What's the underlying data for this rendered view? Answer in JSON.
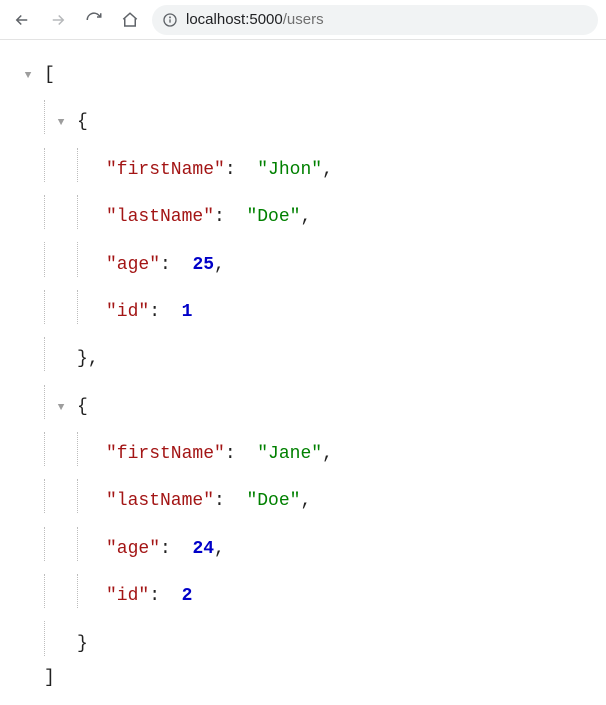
{
  "toolbar": {
    "url_host": "localhost:5000",
    "url_path": "/users"
  },
  "json": {
    "open_bracket": "[",
    "close_bracket": "]",
    "open_brace": "{",
    "close_brace": "}",
    "comma": ",",
    "colon": ":",
    "quote": "\"",
    "users": [
      {
        "props": [
          {
            "key": "firstName",
            "type": "string",
            "value": "Jhon"
          },
          {
            "key": "lastName",
            "type": "string",
            "value": "Doe"
          },
          {
            "key": "age",
            "type": "number",
            "value": "25"
          },
          {
            "key": "id",
            "type": "number",
            "value": "1"
          }
        ]
      },
      {
        "props": [
          {
            "key": "firstName",
            "type": "string",
            "value": "Jane"
          },
          {
            "key": "lastName",
            "type": "string",
            "value": "Doe"
          },
          {
            "key": "age",
            "type": "number",
            "value": "24"
          },
          {
            "key": "id",
            "type": "number",
            "value": "2"
          }
        ]
      }
    ]
  }
}
